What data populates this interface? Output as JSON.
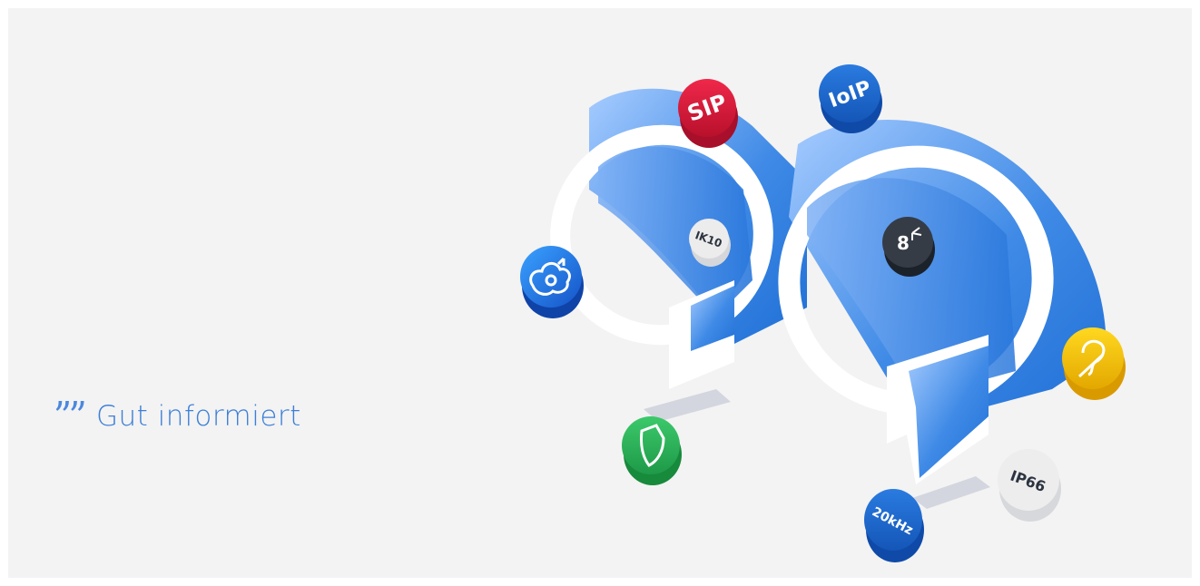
{
  "tagline": {
    "quote_mark": "””",
    "text": "Gut informiert"
  },
  "badges": {
    "sip": "SIP",
    "ioip": "IoIP",
    "ik10": "IK10",
    "dial": "8",
    "ip66": "IP66",
    "khz": "20kHz"
  },
  "colors": {
    "background": "#f3f3f3",
    "accent_blue": "#2f7be0",
    "sip_red": "#d91a3c",
    "shield_green": "#2fb25a",
    "hearing_yellow": "#f7c600",
    "text_blue": "#3d7fd8"
  },
  "icons": [
    "cloud-users-icon",
    "shield-icon",
    "hearing-assist-icon",
    "keypad-icon"
  ]
}
